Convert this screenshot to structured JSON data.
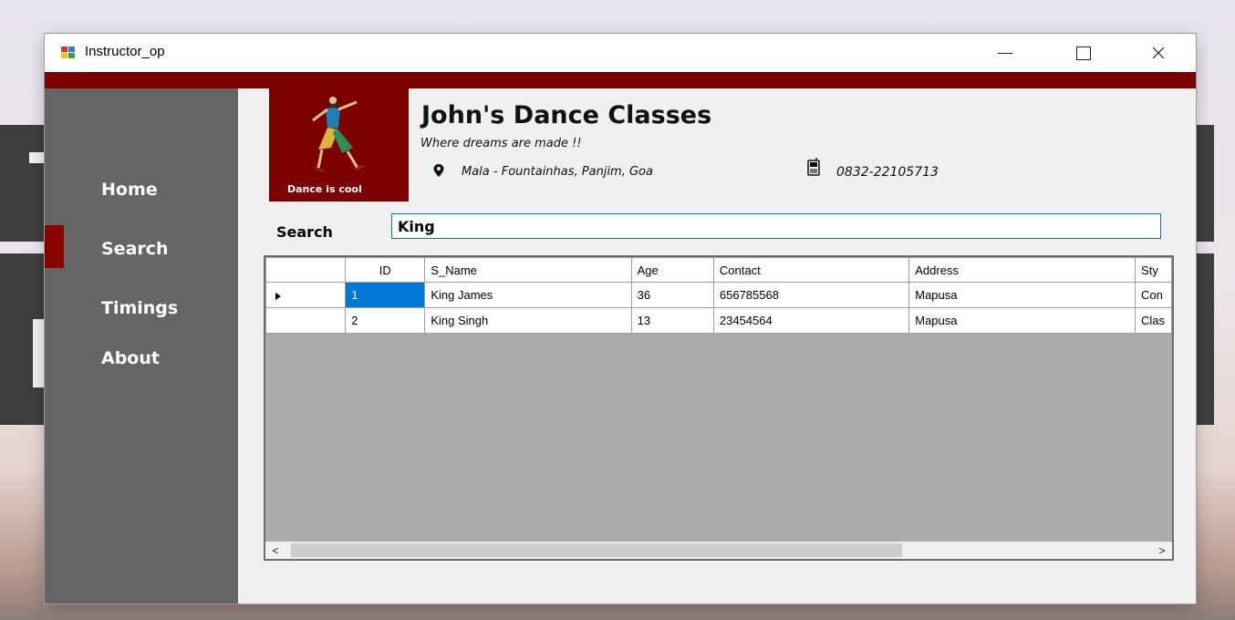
{
  "window": {
    "title": "Instructor_op",
    "accent_color": "#7d0000",
    "sidebar_color": "#656565"
  },
  "sidebar": {
    "items": [
      {
        "label": "Home"
      },
      {
        "label": "Search",
        "active": true
      },
      {
        "label": "Timings"
      },
      {
        "label": "About"
      }
    ]
  },
  "header": {
    "logo_caption": "Dance is cool",
    "title": "John's Dance Classes",
    "tagline": "Where dreams are made !!",
    "location": "Mala - Fountainhas, Panjim, Goa",
    "phone": "0832-22105713"
  },
  "search": {
    "label": "Search",
    "value": "King"
  },
  "grid": {
    "columns": [
      "ID",
      "S_Name",
      "Age",
      "Contact",
      "Address",
      "Sty"
    ],
    "rows": [
      {
        "id": "1",
        "s_name": "King James",
        "age": "36",
        "contact": "656785568",
        "address": "Mapusa",
        "style": "Con",
        "current": true
      },
      {
        "id": "2",
        "s_name": "King Singh",
        "age": "13",
        "contact": "23454564",
        "address": "Mapusa",
        "style": "Clas",
        "current": false
      }
    ],
    "selection_color": "#0078d7"
  },
  "scrollbar": {
    "left_arrow": "<",
    "right_arrow": ">"
  }
}
